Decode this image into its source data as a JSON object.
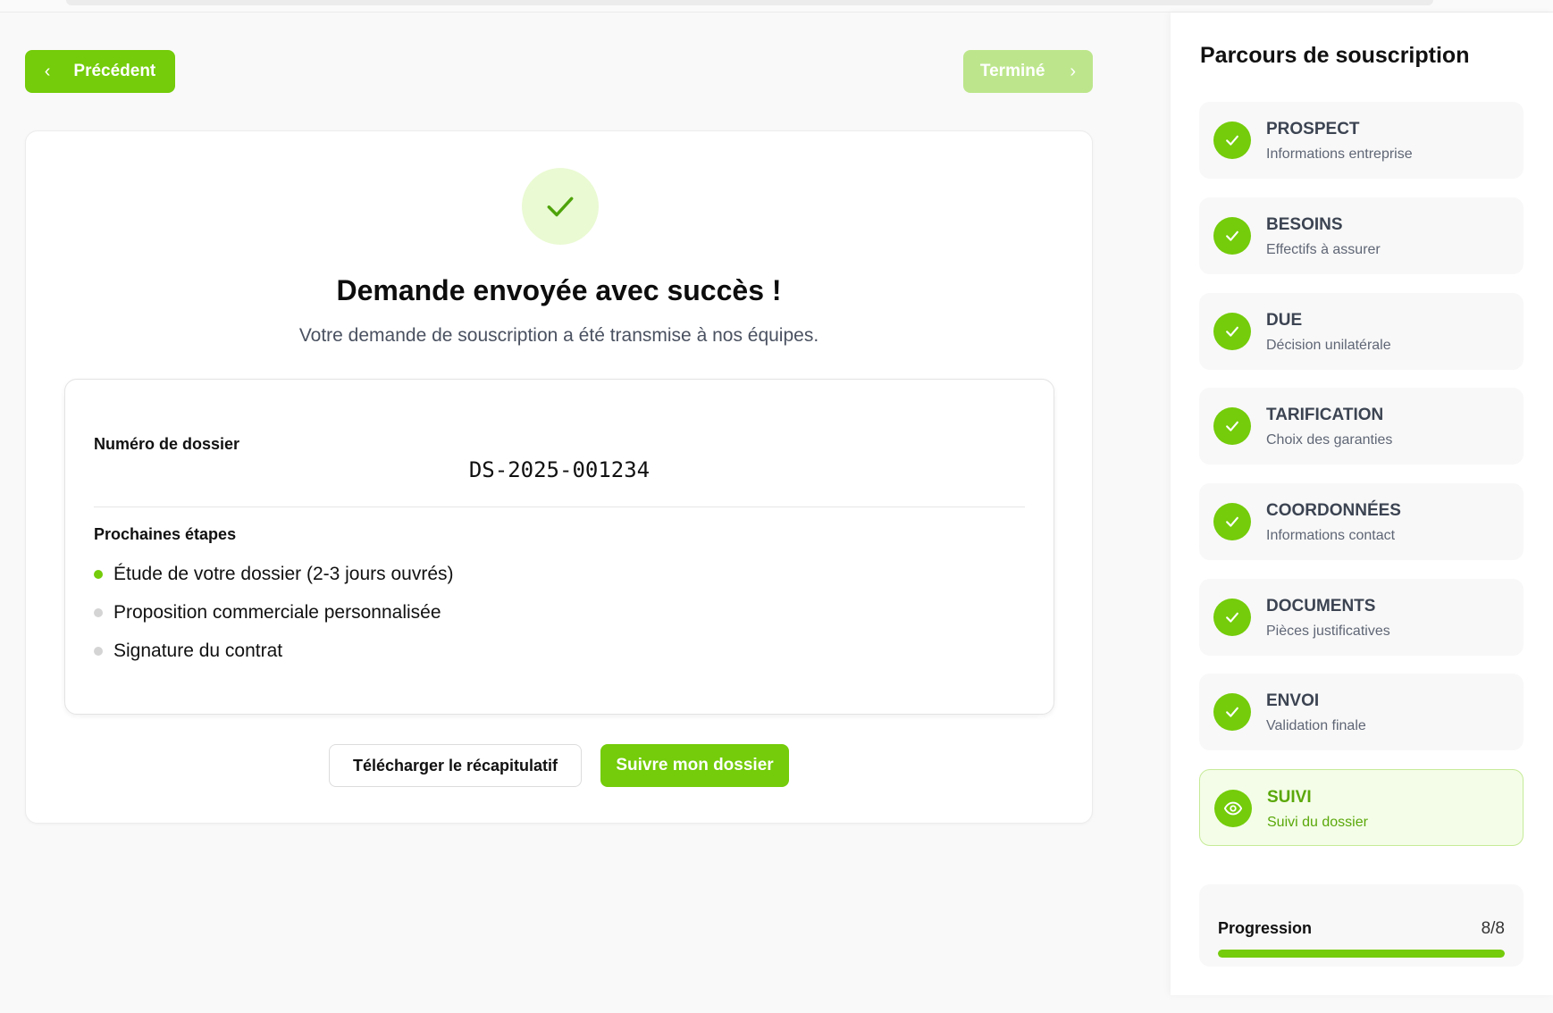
{
  "nav": {
    "prev_label": "Précédent",
    "next_label": "Terminé"
  },
  "success": {
    "title": "Demande envoyée avec succès !",
    "subtitle": "Votre demande de souscription a été transmise à nos équipes."
  },
  "dossier": {
    "label": "Numéro de dossier",
    "number": "DS-2025-001234"
  },
  "next_steps": {
    "label": "Prochaines étapes",
    "items": [
      "Étude de votre dossier (2-3 jours ouvrés)",
      "Proposition commerciale personnalisée",
      "Signature du contrat"
    ]
  },
  "actions": {
    "download_label": "Télécharger le récapitulatif",
    "track_label": "Suivre mon dossier"
  },
  "sidebar": {
    "title": "Parcours de souscription",
    "steps": [
      {
        "name": "PROSPECT",
        "desc": "Informations entreprise",
        "icon": "check-icon"
      },
      {
        "name": "BESOINS",
        "desc": "Effectifs à assurer",
        "icon": "check-icon"
      },
      {
        "name": "DUE",
        "desc": "Décision unilatérale",
        "icon": "check-icon"
      },
      {
        "name": "TARIFICATION",
        "desc": "Choix des garanties",
        "icon": "check-icon"
      },
      {
        "name": "COORDONNÉES",
        "desc": "Informations contact",
        "icon": "check-icon"
      },
      {
        "name": "DOCUMENTS",
        "desc": "Pièces justificatives",
        "icon": "check-icon"
      },
      {
        "name": "ENVOI",
        "desc": "Validation finale",
        "icon": "check-icon"
      },
      {
        "name": "SUIVI",
        "desc": "Suivi du dossier",
        "icon": "eye-icon"
      }
    ],
    "progress": {
      "label": "Progression",
      "count": "8/8",
      "fraction": 1.0
    }
  },
  "colors": {
    "accent": "#74cc0a",
    "accent_light": "#eafad3",
    "accent_disabled": "#bde68c"
  }
}
